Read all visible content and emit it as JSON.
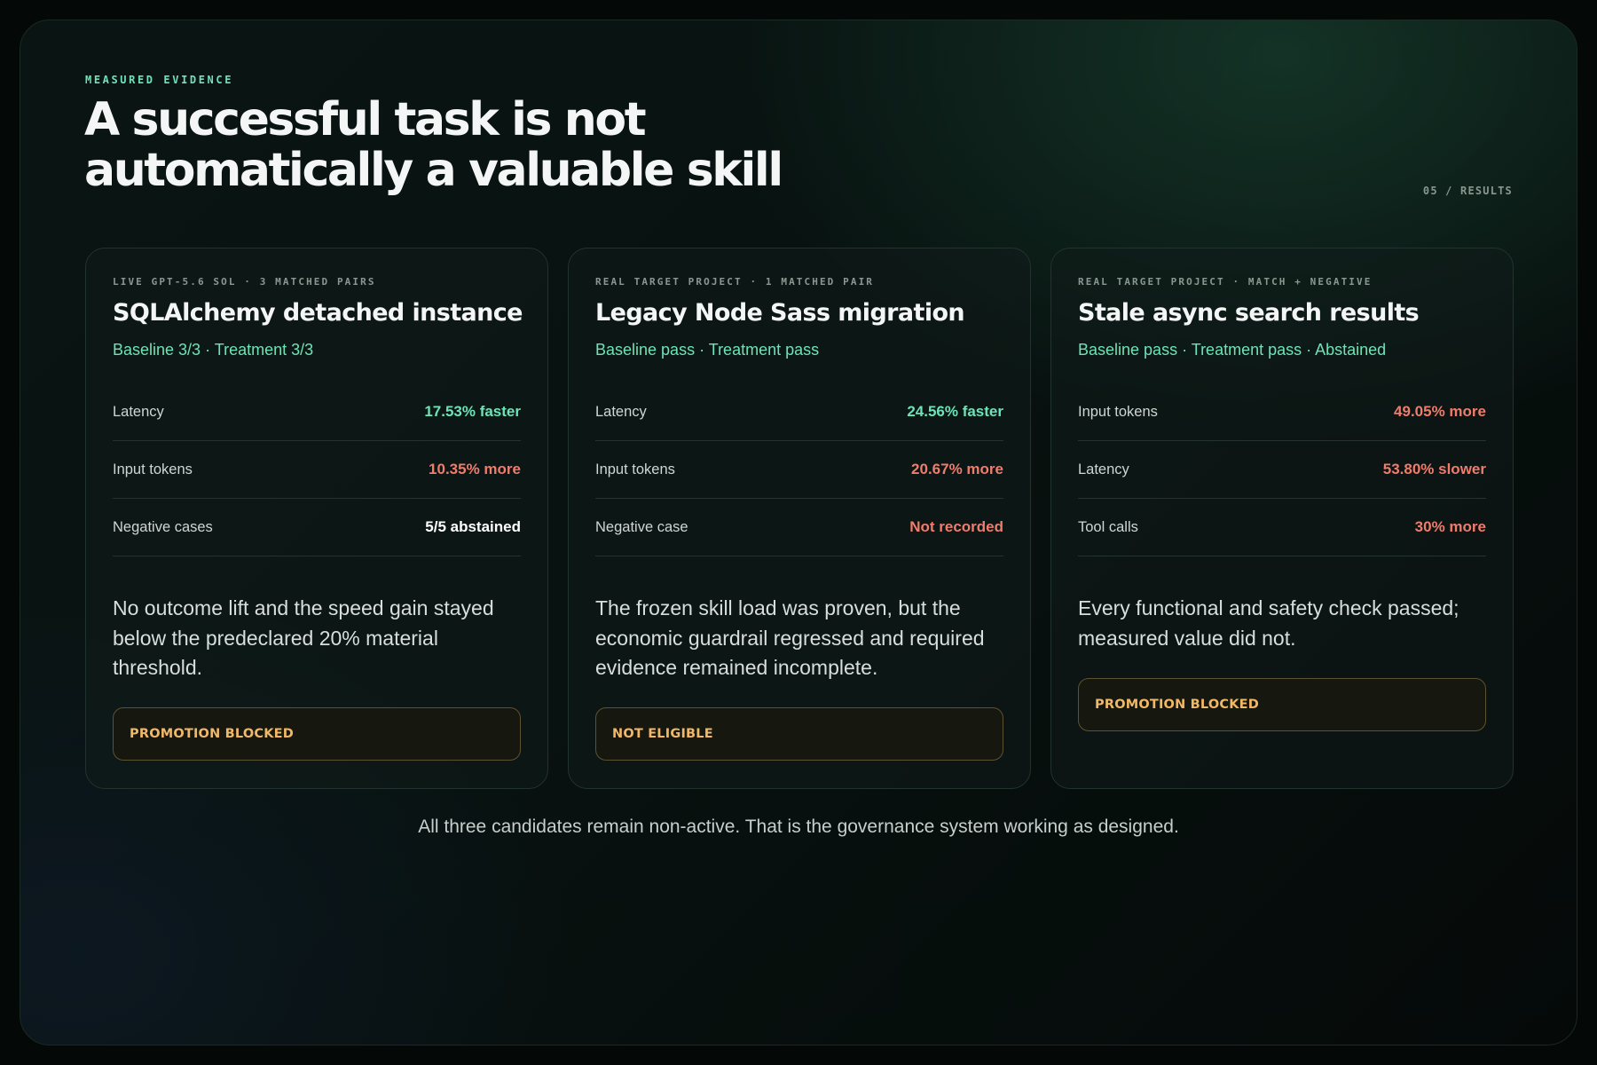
{
  "eyebrow": "MEASURED EVIDENCE",
  "headline": "A successful task is not automatically a valuable skill",
  "page_tag": "05 / RESULTS",
  "cards": [
    {
      "kicker": "LIVE GPT-5.6 SOL · 3 MATCHED PAIRS",
      "title": "SQLAlchemy detached instance",
      "subtitle": "Baseline 3/3 · Treatment 3/3",
      "metrics": [
        {
          "label": "Latency",
          "value": "17.53% faster",
          "tone": "positive"
        },
        {
          "label": "Input tokens",
          "value": "10.35% more",
          "tone": "negative"
        },
        {
          "label": "Negative cases",
          "value": "5/5 abstained",
          "tone": "neutral"
        }
      ],
      "note": "No outcome lift and the speed gain stayed below the predeclared 20% material threshold.",
      "badge": "PROMOTION BLOCKED"
    },
    {
      "kicker": "REAL TARGET PROJECT · 1 MATCHED PAIR",
      "title": "Legacy Node Sass migration",
      "subtitle": "Baseline pass · Treatment pass",
      "metrics": [
        {
          "label": "Latency",
          "value": "24.56% faster",
          "tone": "positive"
        },
        {
          "label": "Input tokens",
          "value": "20.67% more",
          "tone": "negative"
        },
        {
          "label": "Negative case",
          "value": "Not recorded",
          "tone": "negative"
        }
      ],
      "note": "The frozen skill load was proven, but the economic guardrail regressed and required evidence remained incomplete.",
      "badge": "NOT ELIGIBLE"
    },
    {
      "kicker": "REAL TARGET PROJECT · MATCH + NEGATIVE",
      "title": "Stale async search results",
      "subtitle": "Baseline pass · Treatment pass · Abstained",
      "metrics": [
        {
          "label": "Input tokens",
          "value": "49.05% more",
          "tone": "negative"
        },
        {
          "label": "Latency",
          "value": "53.80% slower",
          "tone": "negative"
        },
        {
          "label": "Tool calls",
          "value": "30% more",
          "tone": "negative"
        }
      ],
      "note": "Every functional and safety check passed; measured value did not.",
      "badge": "PROMOTION BLOCKED"
    }
  ],
  "footer": "All three candidates remain non-active. That is the governance system working as designed.",
  "colors": {
    "accent_green": "#6fe3b8",
    "negative_red": "#f07c6c",
    "badge_amber": "#f1b867"
  }
}
